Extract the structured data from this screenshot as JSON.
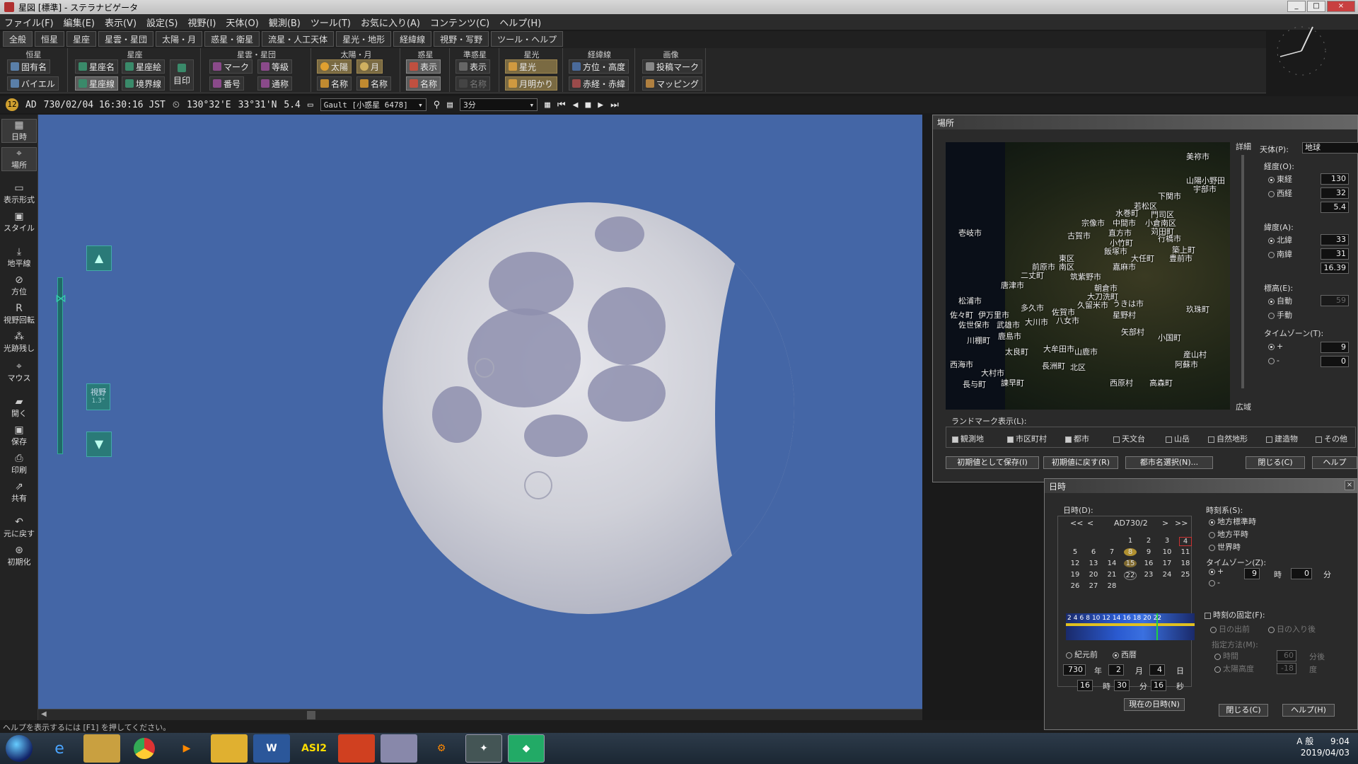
{
  "window": {
    "title": "星図 [標準] - ステラナビゲータ",
    "min": "_",
    "max": "□",
    "close": "×"
  },
  "menu": [
    "ファイル(F)",
    "編集(E)",
    "表示(V)",
    "設定(S)",
    "視野(I)",
    "天体(O)",
    "観測(B)",
    "ツール(T)",
    "お気に入り(A)",
    "コンテンツ(C)",
    "ヘルプ(H)"
  ],
  "tabs": [
    "全般",
    "恒星",
    "星座",
    "星雲・星団",
    "太陽・月",
    "惑星・衛星",
    "流星・人工天体",
    "星光・地形",
    "経緯線",
    "視野・写野",
    "ツール・ヘルプ"
  ],
  "ribbon": {
    "groups": [
      "恒星",
      "星座",
      "星雲・星団",
      "太陽・月",
      "惑星",
      "準惑星",
      "星光",
      "経緯線",
      "画像"
    ],
    "star": [
      "固有名",
      "バイエル"
    ],
    "const": [
      "星座名",
      "星座絵",
      "星座線",
      "境界線",
      "目印"
    ],
    "nebula": [
      "マーク",
      "等級",
      "番号",
      "通称"
    ],
    "sunmoon": [
      "太陽",
      "月",
      "名称",
      "名称"
    ],
    "planet": [
      "表示",
      "名称"
    ],
    "dwarf": [
      "表示",
      "名称"
    ],
    "light": [
      "星光",
      "月明かり"
    ],
    "grid": [
      "方位・高度",
      "赤経・赤緯"
    ],
    "image": [
      "投稿マーク",
      "マッピング"
    ]
  },
  "status": {
    "era": "AD",
    "datetime": "730/02/04 16:30:16 JST",
    "lon": "130°32'E",
    "lat": "33°31'N",
    "mag": "5.4",
    "catalog": "Gault [小惑星 6478]",
    "step": "3分"
  },
  "lefttool": [
    "日時",
    "場所",
    "表示形式",
    "スタイル",
    "地平線",
    "方位",
    "視野回転",
    "光跡残し",
    "マウス",
    "開く",
    "保存",
    "印刷",
    "共有",
    "元に戻す",
    "初期化"
  ],
  "view": {
    "label": "視野",
    "value": "1.3°"
  },
  "help_line": "ヘルプを表示するには [F1] を押してください。",
  "location": {
    "title": "場所",
    "detail": "詳細",
    "wide": "広域",
    "body_label": "天体(P):",
    "body_value": "地球",
    "lon_label": "経度(O):",
    "east": "東経",
    "west": "西経",
    "lon_deg": "130",
    "lon_min": "32",
    "lon_sec": "5.4",
    "lat_label": "緯度(A):",
    "north": "北緯",
    "south": "南緯",
    "lat_deg": "33",
    "lat_min": "31",
    "lat_sec": "16.39",
    "alt_label": "標高(E):",
    "auto": "自動",
    "manual": "手動",
    "alt_value": "59",
    "tz_label": "タイムゾーン(T):",
    "plus": "+",
    "minus": "-",
    "tz_h": "9",
    "tz_m": "0",
    "landmark_label": "ランドマーク表示(L):",
    "landmarks": [
      "観測地",
      "市区町村",
      "都市",
      "天文台",
      "山岳",
      "自然地形",
      "建造物",
      "その他"
    ],
    "buttons": [
      "初期値として保存(I)",
      "初期値に戻す(R)",
      "都市名選択(N)...",
      "閉じる(C)",
      "ヘルプ"
    ],
    "cities": [
      "美祢市",
      "山陽小野田",
      "宇部市",
      "下関市",
      "壱岐市",
      "若松区",
      "水巻町",
      "門司区",
      "宗像市",
      "中間市",
      "小倉南区",
      "古賀市",
      "直方市",
      "苅田町",
      "行橋市",
      "小竹町",
      "飯塚市",
      "築上町",
      "東区",
      "大任町",
      "豊前市",
      "前原市",
      "南区",
      "嘉麻市",
      "二丈町",
      "筑紫野市",
      "唐津市",
      "朝倉市",
      "大刀洗町",
      "松浦市",
      "多久市",
      "佐賀市",
      "久留米市",
      "うきは市",
      "玖珠町",
      "佐々町",
      "伊万里市",
      "大川市",
      "八女市",
      "星野村",
      "佐世保市",
      "武雄市",
      "矢部村",
      "川棚町",
      "鹿島市",
      "小国町",
      "太良町",
      "大牟田市",
      "山鹿市",
      "産山村",
      "西海市",
      "長洲町",
      "北区",
      "阿蘇市",
      "大村市",
      "長与町",
      "諫早町",
      "西原村",
      "高森町"
    ]
  },
  "datetime": {
    "title": "日時",
    "date_label": "日時(D):",
    "month_title": "AD730/2",
    "nav": [
      "<<",
      "<",
      ">",
      ">>"
    ],
    "days": [
      "1",
      "2",
      "3",
      "4",
      "5",
      "6",
      "7",
      "8",
      "9",
      "10",
      "11",
      "12",
      "13",
      "14",
      "15",
      "16",
      "17",
      "18",
      "19",
      "20",
      "21",
      "22",
      "23",
      "24",
      "25",
      "26",
      "27",
      "28"
    ],
    "hours": [
      "2",
      "4",
      "6",
      "8",
      "10",
      "12",
      "14",
      "16",
      "18",
      "20",
      "22"
    ],
    "bc": "紀元前",
    "ad": "西暦",
    "year": "730",
    "year_u": "年",
    "month": "2",
    "month_u": "月",
    "day": "4",
    "day_u": "日",
    "hour": "16",
    "hour_u": "時",
    "minute": "30",
    "minute_u": "分",
    "second": "16",
    "second_u": "秒",
    "now_btn": "現在の日時(N)",
    "tsys_label": "時刻系(S):",
    "tsys": [
      "地方標準時",
      "地方平時",
      "世界時"
    ],
    "tz_label": "タイムゾーン(Z):",
    "tz_plus": "+",
    "tz_minus": "-",
    "tz_h": "9",
    "tz_h_u": "時",
    "tz_m": "0",
    "tz_m_u": "分",
    "fix_label": "時刻の固定(F):",
    "sunrise": "日の出前",
    "sunset": "日の入り後",
    "method_label": "指定方法(M):",
    "m_time": "時間",
    "m_time_v": "60",
    "m_time_u": "分後",
    "m_alt": "太陽高度",
    "m_alt_v": "-18",
    "m_alt_u": "度",
    "close_btn": "閉じる(C)",
    "help_btn": "ヘルプ(H)"
  },
  "taskbar": {
    "apps": [
      "IE",
      "Explorer",
      "Chrome",
      "Media",
      "Mail",
      "Word",
      "ASI2",
      "Office",
      "Calc",
      "Tool",
      "StellaNavi",
      "App"
    ],
    "time": "9:04",
    "date": "2019/04/03",
    "ime": "A 般"
  }
}
